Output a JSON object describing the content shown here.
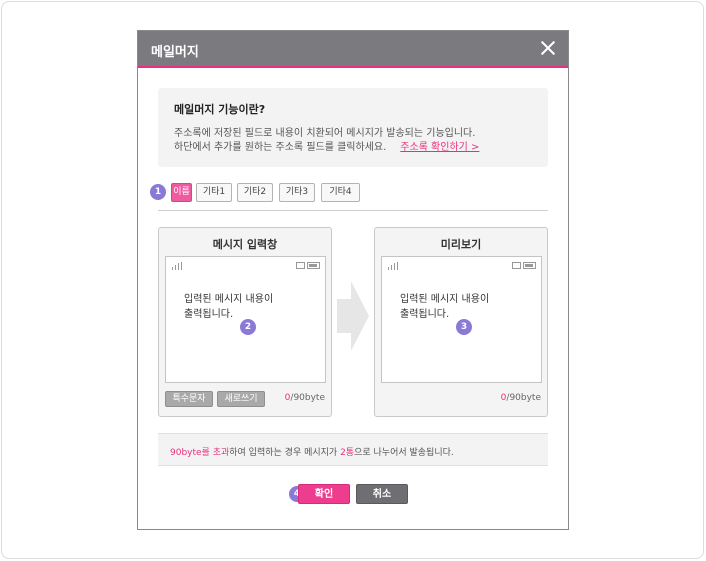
{
  "dialog": {
    "title": "메일머지"
  },
  "info": {
    "title": "메일머지 기능이란?",
    "line1": "주소록에 저장된 필드로 내용이 치환되어 메시지가 발송되는 기능입니다.",
    "line2": "하단에서 추가를 원하는 주소록 필드를 클릭하세요.",
    "link": "주소록 확인하기 >"
  },
  "fields": [
    "이름",
    "기타1",
    "기타2",
    "기타3",
    "기타4"
  ],
  "badges": [
    "1",
    "2",
    "3",
    "4"
  ],
  "input_panel": {
    "title": "메시지 입력창",
    "message_line1": "입력된 메시지 내용이",
    "message_line2": "출력됩니다.",
    "special_chars_button": "특수문자",
    "rewrite_button": "새로쓰기",
    "count": "0",
    "limit": "/90byte"
  },
  "preview_panel": {
    "title": "미리보기",
    "message_line1": "입력된 메시지 내용이",
    "message_line2": "출력됩니다.",
    "count": "0",
    "limit": "/90byte"
  },
  "notice": {
    "part1": "90byte를 초과",
    "part2": "하여 입력하는 경우 메시지가 ",
    "part3": "2통",
    "part4": "으로 나누어서 발송됩니다."
  },
  "buttons": {
    "confirm": "확인",
    "cancel": "취소"
  },
  "colors": {
    "accent": "#e8307e",
    "titlebar": "#7b7b7f",
    "badge": "#8b79d6"
  }
}
